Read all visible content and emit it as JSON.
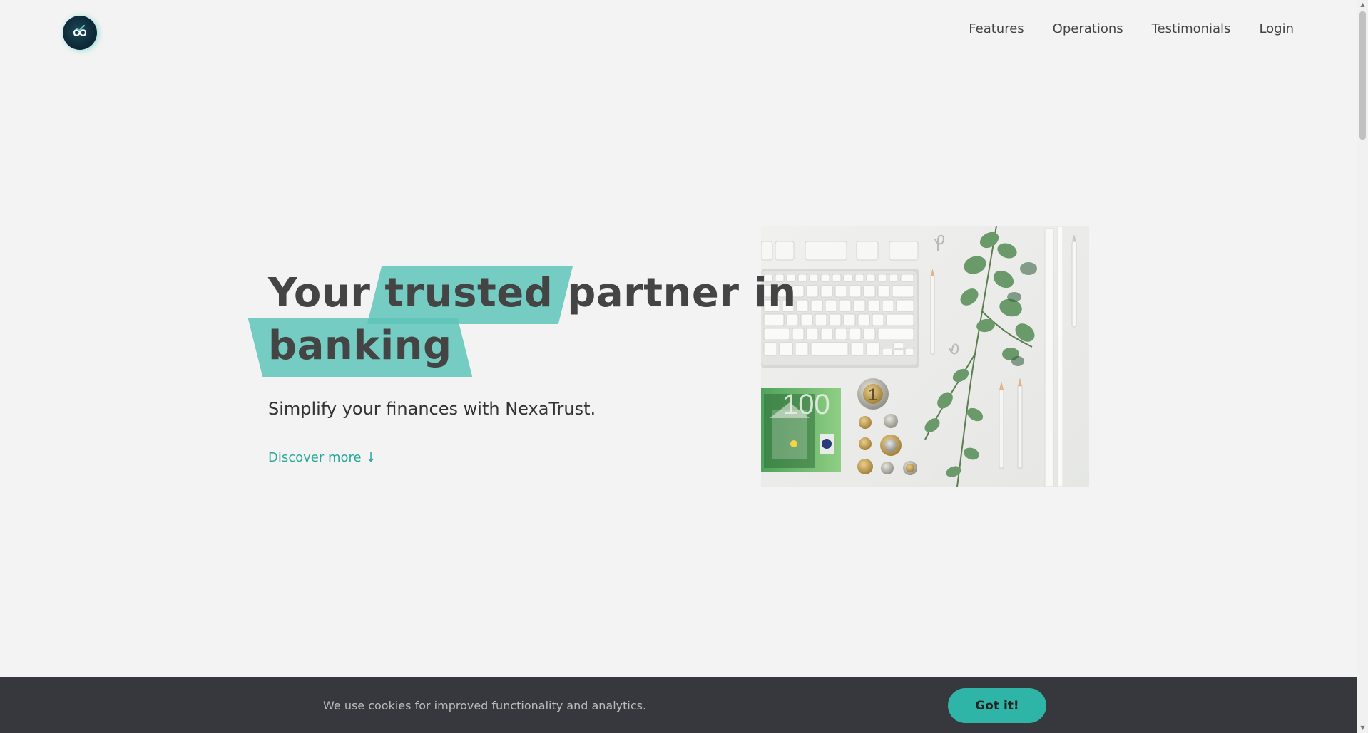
{
  "brand": {
    "logo_icon": "nexatrust-logo-icon",
    "accent_color": "#5ec4b8",
    "link_color": "#2aa99c"
  },
  "nav": {
    "items": [
      {
        "label": "Features"
      },
      {
        "label": "Operations"
      },
      {
        "label": "Testimonials"
      },
      {
        "label": "Login"
      }
    ]
  },
  "hero": {
    "title_part1": "Your",
    "title_highlight1": "trusted",
    "title_part2": "partner in",
    "title_highlight2": "banking",
    "subtitle": "Simplify your finances with NexaTrust.",
    "cta_label": "Discover more ↓",
    "banknote_value": "100",
    "coin_value": "1"
  },
  "cookie_bar": {
    "message": "We use cookies for improved functionality and analytics.",
    "button_label": "Got it!"
  }
}
